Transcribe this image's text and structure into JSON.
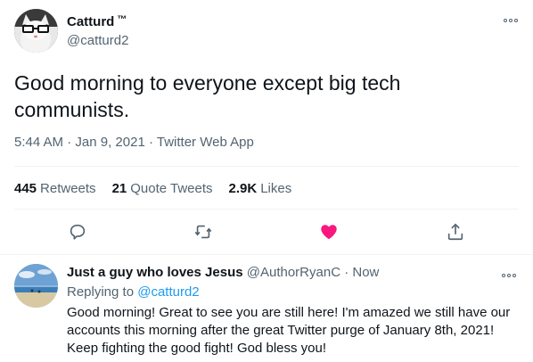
{
  "tweet": {
    "author_name": "Catturd",
    "trademark": "™",
    "handle": "@catturd2",
    "text": "Good morning to everyone except big tech communists.",
    "time": "5:44 AM",
    "date": "Jan 9, 2021",
    "source": "Twitter Web App",
    "stats": {
      "retweets_count": "445",
      "retweets_label": "Retweets",
      "quote_count": "21",
      "quote_label": "Quote Tweets",
      "likes_count": "2.9K",
      "likes_label": "Likes"
    },
    "actions": {
      "reply_icon": "reply-icon",
      "retweet_icon": "retweet-icon",
      "like_icon": "heart-filled-icon",
      "share_icon": "share-icon"
    }
  },
  "reply": {
    "author_name": "Just a guy who loves Jesus",
    "handle": "@AuthorRyanC",
    "separator": "·",
    "time": "Now",
    "replying_prefix": "Replying to",
    "replying_to": "@catturd2",
    "text": "Good morning! Great to see you are still here! I'm amazed we still have our accounts this morning after the great Twitter purge of January 8th, 2021! Keep fighting the good fight! God bless you!"
  },
  "colors": {
    "text_primary": "#0f1419",
    "text_secondary": "#536471",
    "link": "#1d9bf0",
    "like_red": "#f91880",
    "divider": "#eff3f4"
  }
}
